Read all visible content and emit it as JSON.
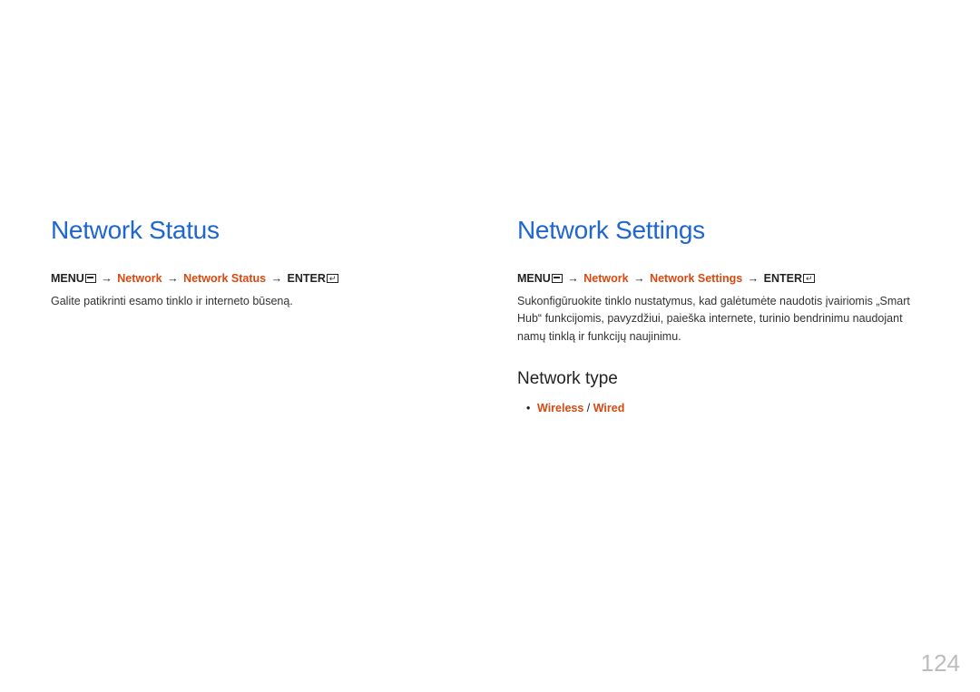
{
  "left": {
    "heading": "Network Status",
    "menu": "MENU",
    "net": "Network",
    "status": "Network Status",
    "enter": "ENTER",
    "arrow": "→",
    "desc": "Galite patikrinti esamo tinklo ir interneto būseną."
  },
  "right": {
    "heading": "Network Settings",
    "menu": "MENU",
    "net": "Network",
    "settings": "Network Settings",
    "enter": "ENTER",
    "arrow": "→",
    "desc": "Sukonfigūruokite tinklo nustatymus, kad galėtumėte naudotis įvairiomis „Smart Hub“ funkcijomis, pavyzdžiui, paieška internete, turinio bendrinimu naudojant namų tinklą ir funkcijų naujinimu.",
    "subhead": "Network type",
    "opt1": "Wireless",
    "sep": " / ",
    "opt2": "Wired"
  },
  "pageNumber": "124"
}
